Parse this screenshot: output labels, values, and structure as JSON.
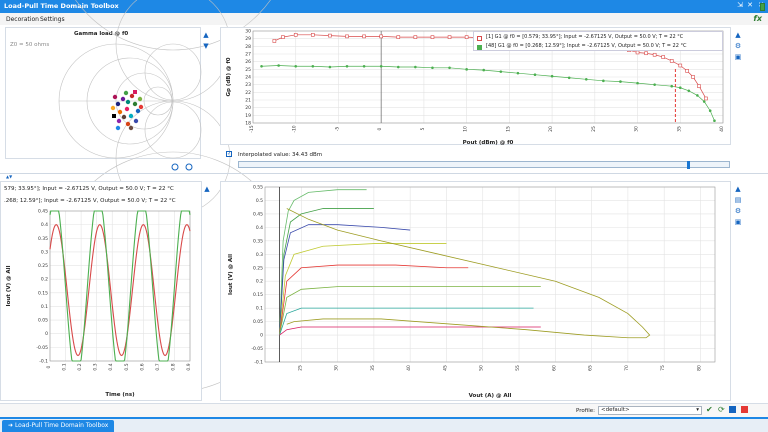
{
  "window": {
    "title": "Load-Pull Time Domain Toolbox",
    "controls": [
      "⇲",
      "✕",
      "✕"
    ]
  },
  "menu": {
    "items": [
      "Decoration",
      "Settings"
    ]
  },
  "fx_label": "fx",
  "smith": {
    "title": "Gamma load @ f0",
    "ref_label": "Z0 = 50 ohms"
  },
  "gp_chart": {
    "legend": [
      "[1] G1 @ f0 = [0.579; 33.95°]; Input = -2.67125 V, Output = 50.0 V; T = 22 °C",
      "[48] G1 @ f0 = [0.268; 12.59°]; Input = -2.67125 V, Output = 50.0 V; T = 22 °C"
    ]
  },
  "interpolated": {
    "label": "Interpolated value:",
    "value": "34.43 dBm"
  },
  "time_header": {
    "line1": "579; 33.95°]; Input = -2.67125 V, Output = 50.0 V; T = 22 °C",
    "line2": ".268; 12.59°]; Input = -2.67125 V, Output = 50.0 V; T = 22 °C"
  },
  "profile": {
    "label": "Profile:",
    "value": "<default>"
  },
  "bottom_tab": "Load-Pull Time Domain Toolbox",
  "colors": {
    "accent": "#1e88e5",
    "series1": "#d84a4a",
    "series2": "#4caf50",
    "marker": "#e53935"
  },
  "chart_data": [
    {
      "type": "line",
      "title": "",
      "xlabel": "Pout (dBm) @ f0",
      "ylabel": "Gp (dB) @ f0",
      "xlim": [
        -15,
        40
      ],
      "ylim": [
        18,
        30
      ],
      "xticks": [
        -15,
        -10,
        -5,
        0,
        5,
        10,
        15,
        20,
        25,
        30,
        35,
        40
      ],
      "yticks": [
        18,
        19,
        20,
        21,
        22,
        23,
        24,
        25,
        26,
        27,
        28,
        29,
        30
      ],
      "marker_x": 34.43,
      "series": [
        {
          "name": "[1] G1 @ f0 = [0.579; 33.95°]; Input = -2.67125 V, Output = 50.0 V; T = 22 °C",
          "x": [
            -12.5,
            -11.5,
            -10,
            -8,
            -6,
            -4,
            -2,
            0,
            2,
            4,
            6,
            8,
            10,
            12,
            14,
            16,
            18,
            20,
            22,
            24,
            25,
            26,
            27,
            28,
            29,
            30,
            31,
            32,
            33,
            34,
            35,
            35.8,
            36.5,
            37.2,
            38
          ],
          "y": [
            28.7,
            29.2,
            29.5,
            29.5,
            29.4,
            29.3,
            29.3,
            29.3,
            29.2,
            29.2,
            29.2,
            29.2,
            29.2,
            29.1,
            29.1,
            29.1,
            29.0,
            28.9,
            28.7,
            28.5,
            28.3,
            28.1,
            27.9,
            27.7,
            27.5,
            27.2,
            27.1,
            26.9,
            26.6,
            26.1,
            25.5,
            24.8,
            24.0,
            22.8,
            21.2
          ]
        },
        {
          "name": "[48] G1 @ f0 = [0.268; 12.59°]; Input = -2.67125 V, Output = 50.0 V; T = 22 °C",
          "x": [
            -14,
            -12,
            -10,
            -8,
            -6,
            -4,
            -2,
            0,
            2,
            4,
            6,
            8,
            10,
            12,
            14,
            16,
            18,
            20,
            22,
            24,
            26,
            28,
            30,
            32,
            34,
            35,
            36,
            37,
            37.8,
            38.5,
            39
          ],
          "y": [
            25.4,
            25.5,
            25.4,
            25.4,
            25.3,
            25.4,
            25.4,
            25.4,
            25.3,
            25.3,
            25.2,
            25.2,
            25.0,
            24.9,
            24.7,
            24.5,
            24.3,
            24.1,
            23.9,
            23.7,
            23.5,
            23.4,
            23.2,
            23.0,
            22.8,
            22.6,
            22.2,
            21.6,
            20.8,
            19.6,
            18.3
          ]
        }
      ]
    },
    {
      "type": "line",
      "title": "",
      "xlabel": "Time (ns)",
      "ylabel": "Iout (V) @ All",
      "xlim": [
        0,
        0.9
      ],
      "ylim": [
        -0.1,
        0.45
      ],
      "xticks": [
        0,
        0.1,
        0.2,
        0.3,
        0.4,
        0.5,
        0.6,
        0.7,
        0.8,
        0.9
      ],
      "yticks": [
        -0.1,
        -0.05,
        0,
        0.05,
        0.1,
        0.15,
        0.2,
        0.25,
        0.3,
        0.35,
        0.4,
        0.45
      ],
      "series": [
        {
          "amplitude": 0.24,
          "offset": 0.16,
          "period_ns": 0.28,
          "phase_ns": 0.04
        },
        {
          "amplitude": 0.34,
          "offset": 0.17,
          "period_ns": 0.28,
          "phase_ns": 0.03
        }
      ]
    },
    {
      "type": "line",
      "title": "",
      "xlabel": "Vout (A) @ All",
      "ylabel": "Iout (V) @ All",
      "xlim": [
        20,
        82
      ],
      "ylim": [
        -0.1,
        0.55
      ],
      "xticks": [
        25,
        30,
        35,
        40,
        45,
        50,
        55,
        60,
        65,
        70,
        75,
        80
      ],
      "yticks": [
        -0.1,
        -0.05,
        0,
        0.05,
        0.1,
        0.15,
        0.2,
        0.25,
        0.3,
        0.35,
        0.4,
        0.45,
        0.5,
        0.55
      ],
      "series": [
        {
          "x": [
            22,
            22.5,
            23.2,
            24,
            26,
            30,
            34
          ],
          "y": [
            0,
            0.35,
            0.46,
            0.5,
            0.53,
            0.54,
            0.54
          ],
          "color": "#66bb6a"
        },
        {
          "x": [
            22,
            22.6,
            23.5,
            25,
            28,
            32,
            35
          ],
          "y": [
            0,
            0.3,
            0.42,
            0.45,
            0.47,
            0.47,
            0.47
          ],
          "color": "#43a047"
        },
        {
          "x": [
            22,
            22.6,
            23.5,
            26,
            30,
            36,
            40
          ],
          "y": [
            0,
            0.28,
            0.38,
            0.41,
            0.41,
            0.4,
            0.39
          ],
          "color": "#3949ab"
        },
        {
          "x": [
            22,
            22.8,
            24,
            28,
            35,
            42,
            45
          ],
          "y": [
            0,
            0.22,
            0.3,
            0.33,
            0.34,
            0.34,
            0.34
          ],
          "color": "#c0ca33"
        },
        {
          "x": [
            22,
            23,
            25,
            30,
            38,
            45,
            48
          ],
          "y": [
            0,
            0.2,
            0.25,
            0.26,
            0.26,
            0.25,
            0.25
          ],
          "color": "#e53935"
        },
        {
          "x": [
            22,
            23,
            25,
            30,
            40,
            50,
            58
          ],
          "y": [
            0,
            0.14,
            0.17,
            0.18,
            0.18,
            0.18,
            0.18
          ],
          "color": "#7cb342"
        },
        {
          "x": [
            22,
            23,
            25,
            30,
            40,
            50,
            57
          ],
          "y": [
            0,
            0.08,
            0.1,
            0.1,
            0.1,
            0.1,
            0.1
          ],
          "color": "#26a69a"
        },
        {
          "x": [
            22,
            23,
            25,
            30,
            40,
            50,
            58
          ],
          "y": [
            0,
            0.02,
            0.03,
            0.03,
            0.03,
            0.03,
            0.03
          ],
          "color": "#d81b60"
        },
        {
          "x": [
            23,
            26,
            30,
            36,
            44,
            52,
            60,
            66,
            70,
            72,
            73,
            72.5,
            70,
            64,
            56,
            46,
            36,
            28,
            24,
            23
          ],
          "y": [
            0.47,
            0.43,
            0.39,
            0.35,
            0.3,
            0.25,
            0.2,
            0.14,
            0.08,
            0.03,
            0.0,
            -0.01,
            -0.01,
            0.0,
            0.02,
            0.04,
            0.06,
            0.06,
            0.05,
            0.04
          ],
          "color": "#9e9d24"
        }
      ]
    }
  ]
}
